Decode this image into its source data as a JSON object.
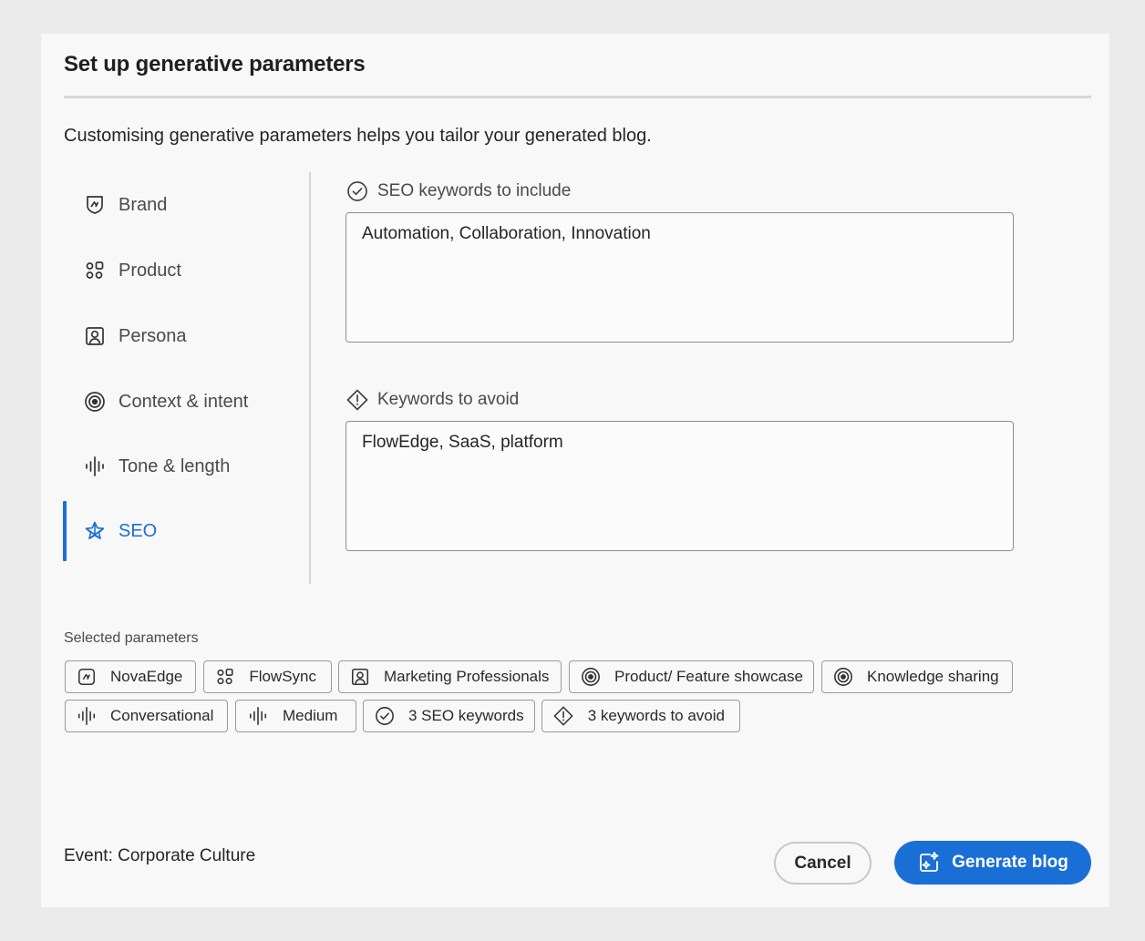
{
  "dialog": {
    "title": "Set up generative parameters",
    "description": "Customising generative parameters helps you tailor your generated blog."
  },
  "nav": {
    "items": [
      {
        "label": "Brand",
        "icon": "brand-shield-icon"
      },
      {
        "label": "Product",
        "icon": "product-grid-icon"
      },
      {
        "label": "Persona",
        "icon": "persona-portrait-icon"
      },
      {
        "label": "Context & intent",
        "icon": "target-icon"
      },
      {
        "label": "Tone & length",
        "icon": "sound-wave-icon"
      },
      {
        "label": "SEO",
        "icon": "seo-star-icon",
        "active": true
      }
    ]
  },
  "seo": {
    "include_label": "SEO keywords to include",
    "include_value": "Automation, Collaboration, Innovation",
    "avoid_label": "Keywords to avoid",
    "avoid_value": "FlowEdge, SaaS, platform"
  },
  "selected": {
    "label": "Selected parameters",
    "chips": [
      {
        "label": "NovaEdge",
        "icon": "brand-shield-icon"
      },
      {
        "label": "FlowSync",
        "icon": "product-grid-icon"
      },
      {
        "label": "Marketing Professionals",
        "icon": "persona-portrait-icon"
      },
      {
        "label": "Product/ Feature showcase",
        "icon": "target-icon"
      },
      {
        "label": "Knowledge sharing",
        "icon": "target-icon"
      },
      {
        "label": "Conversational",
        "icon": "sound-wave-icon"
      },
      {
        "label": "Medium",
        "icon": "sound-wave-icon"
      },
      {
        "label": "3 SEO keywords",
        "icon": "check-circle-icon"
      },
      {
        "label": "3 keywords to avoid",
        "icon": "alert-diamond-icon"
      }
    ]
  },
  "footer": {
    "event": "Event: Corporate Culture",
    "cancel_label": "Cancel",
    "generate_label": "Generate blog"
  },
  "colors": {
    "accent": "#1a6fd6",
    "background": "#ebebeb",
    "dialog": "#f8f8f8"
  }
}
